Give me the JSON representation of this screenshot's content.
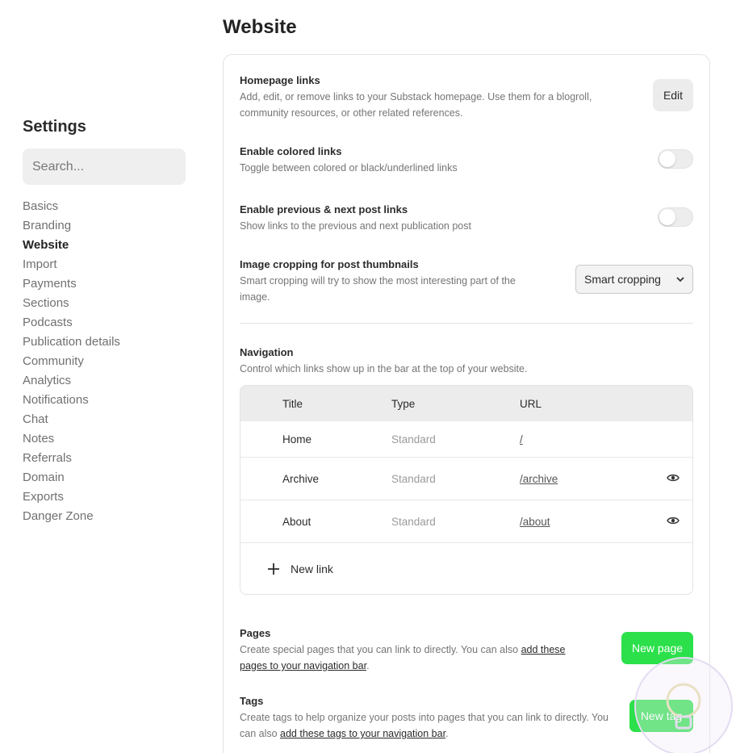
{
  "sidebar": {
    "title": "Settings",
    "search_placeholder": "Search...",
    "items": [
      {
        "label": "Basics"
      },
      {
        "label": "Branding"
      },
      {
        "label": "Website",
        "active": true
      },
      {
        "label": "Import"
      },
      {
        "label": "Payments"
      },
      {
        "label": "Sections"
      },
      {
        "label": "Podcasts"
      },
      {
        "label": "Publication details"
      },
      {
        "label": "Community"
      },
      {
        "label": "Analytics"
      },
      {
        "label": "Notifications"
      },
      {
        "label": "Chat"
      },
      {
        "label": "Notes"
      },
      {
        "label": "Referrals"
      },
      {
        "label": "Domain"
      },
      {
        "label": "Exports"
      },
      {
        "label": "Danger Zone"
      }
    ]
  },
  "main": {
    "title": "Website",
    "homepage_links": {
      "label": "Homepage links",
      "desc": "Add, edit, or remove links to your Substack homepage. Use them for a blogroll, community resources, or other related references.",
      "button": "Edit"
    },
    "colored_links": {
      "label": "Enable colored links",
      "desc": "Toggle between colored or black/underlined links",
      "enabled": false
    },
    "prev_next": {
      "label": "Enable previous & next post links",
      "desc": "Show links to the previous and next publication post",
      "enabled": false
    },
    "image_cropping": {
      "label": "Image cropping for post thumbnails",
      "desc": "Smart cropping will try to show the most interesting part of the image.",
      "selected": "Smart cropping"
    },
    "navigation": {
      "label": "Navigation",
      "desc": "Control which links show up in the bar at the top of your website.",
      "columns": {
        "title": "Title",
        "type": "Type",
        "url": "URL"
      },
      "rows": [
        {
          "title": "Home",
          "type": "Standard",
          "url": "/"
        },
        {
          "title": "Archive",
          "type": "Standard",
          "url": "/archive"
        },
        {
          "title": "About",
          "type": "Standard",
          "url": "/about"
        }
      ],
      "new_link": "New link"
    },
    "pages": {
      "label": "Pages",
      "desc_prefix": "Create special pages that you can link to directly. You can also ",
      "desc_link_a": "add these",
      "desc_link_b": "pages to your navigation bar",
      "desc_suffix": ".",
      "button": "New page"
    },
    "tags": {
      "label": "Tags",
      "desc_prefix": "Create tags to help organize your posts into pages that you can link to directly. You can also ",
      "desc_link": "add these tags to your navigation bar",
      "desc_suffix": ".",
      "button": "New tag"
    }
  },
  "colors": {
    "accent_green": "#2be04a",
    "text_dark": "#2b2b2b",
    "text_muted": "#757575"
  },
  "icons": [
    "chevron-down-icon",
    "eye-icon",
    "plus-icon"
  ]
}
